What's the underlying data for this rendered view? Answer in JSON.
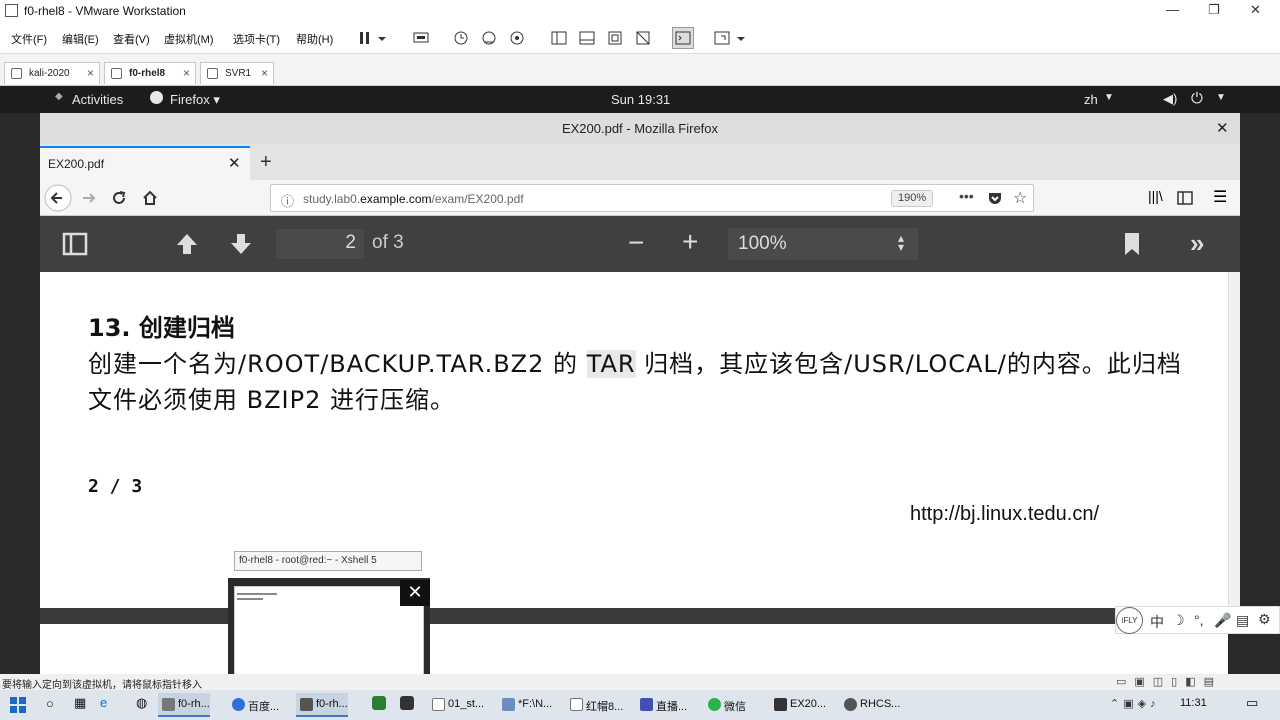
{
  "vmware": {
    "title": "f0-rhel8 - VMware Workstation",
    "menu": [
      "文件(F)",
      "编辑(E)",
      "查看(V)",
      "虚拟机(M)",
      "选项卡(T)",
      "帮助(H)"
    ],
    "tabs": [
      "kali-2020",
      "f0-rhel8",
      "SVR1"
    ],
    "status_text": "要将输入定向到该虚拟机，请将鼠标指针移入"
  },
  "gnome": {
    "activities": "Activities",
    "app_menu": "Firefox ▾",
    "clock": "Sun 19:31",
    "lang": "zh"
  },
  "firefox": {
    "window_title": "EX200.pdf - Mozilla Firefox",
    "tab_title": "EX200.pdf",
    "url_plain_pre": "study.lab0.",
    "url_domain": "example.com",
    "url_path": "/exam/EX200.pdf",
    "zoom_badge": "190%"
  },
  "pdf_viewer": {
    "page_number": "2",
    "page_count": "of 3",
    "scale": "100%"
  },
  "pdf": {
    "heading": "13. 创建归档",
    "line1_pre": "创建一个名为/ROOT/BACKUP.TAR.BZ2 的 ",
    "line1_hl": "TAR",
    "line1_post": " 归档，其应该包含/USR/LOCAL/的内容。此归档",
    "line2": "文件必须使用 BZIP2 进行压缩。",
    "page_indicator": "2 / 3",
    "footer_url": "http://bj.linux.tedu.cn/"
  },
  "xshell_preview": {
    "tooltip": "f0-rhel8 - root@red:~ - Xshell 5"
  },
  "ime": {
    "logo": "iFLY",
    "mode": "中"
  },
  "taskbar": {
    "items": [
      "f0-rh...",
      "百度...",
      "f0-rh...",
      "01_st...",
      "*F:\\N...",
      "红帽8...",
      "直播...",
      "微信",
      "EX20...",
      "RHCS..."
    ],
    "clock": "11:31"
  }
}
